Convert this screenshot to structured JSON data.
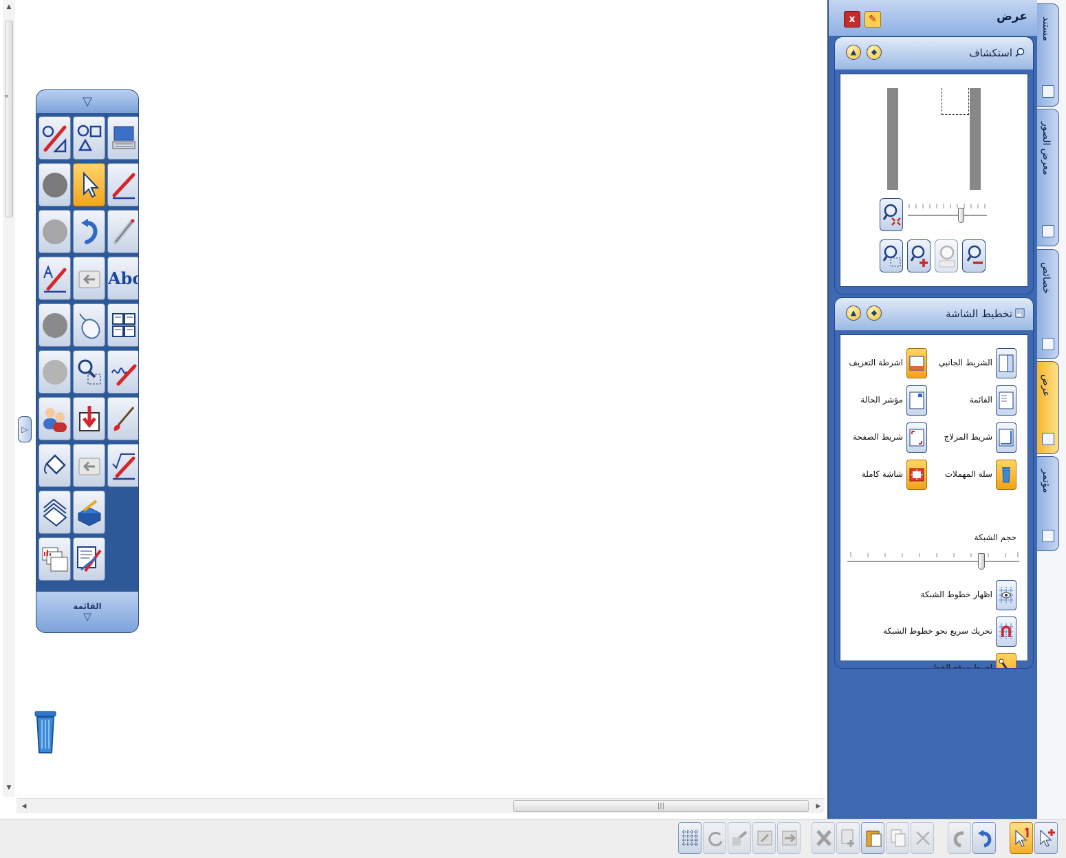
{
  "toolbox": {
    "footer_label": "القائمة",
    "tools": [
      {
        "icon": "magic-pen-icon"
      },
      {
        "icon": "shapes-icon"
      },
      {
        "icon": "on-screen-keyboard-icon"
      },
      {
        "icon": "gray-circle-icon"
      },
      {
        "icon": "select-pointer-icon",
        "active": true
      },
      {
        "icon": "pen-icon"
      },
      {
        "icon": "gray-circle-icon"
      },
      {
        "icon": "undo-icon"
      },
      {
        "icon": "highlighter-icon"
      },
      {
        "icon": "text-pen-icon"
      },
      {
        "icon": "back-arrow-icon"
      },
      {
        "icon": "text-tool-icon",
        "text": "Abc"
      },
      {
        "icon": "gray-circle-icon"
      },
      {
        "icon": "mouse-icon"
      },
      {
        "icon": "table-layout-icon"
      },
      {
        "icon": "gray-circle-icon"
      },
      {
        "icon": "zoom-region-icon"
      },
      {
        "icon": "handwriting-icon"
      },
      {
        "icon": "users-icon"
      },
      {
        "icon": "import-arrow-icon"
      },
      {
        "icon": "brush-icon"
      },
      {
        "icon": "fill-bucket-icon"
      },
      {
        "icon": "back-arrow-icon"
      },
      {
        "icon": "math-pen-icon"
      },
      {
        "icon": "stacked-pages-icon"
      },
      {
        "icon": "toolbox-settings-icon"
      },
      {
        "icon": "empty-slot"
      },
      {
        "icon": "media-icon"
      },
      {
        "icon": "edit-tools-icon"
      }
    ]
  },
  "panel": {
    "title": "عرض",
    "explore": {
      "title": "استكشاف"
    },
    "layout": {
      "title": "تخطيط الشاشة",
      "items": [
        {
          "label": "الشريط الجانبي",
          "icon": "sidebar-layout-icon"
        },
        {
          "label": "اشرطة التعريف",
          "icon": "toolbars-layout-icon"
        },
        {
          "label": "القائمة",
          "icon": "menu-layout-icon"
        },
        {
          "label": "مؤشر الحالة",
          "icon": "status-indicator-icon"
        },
        {
          "label": "شريط المزلاج",
          "icon": "scrollbar-layout-icon"
        },
        {
          "label": "شريط الصفحة",
          "icon": "page-bar-icon"
        },
        {
          "label": "سلة المهملات",
          "icon": "trash-layout-icon"
        },
        {
          "label": "شاشة كاملة",
          "icon": "fullscreen-icon"
        }
      ],
      "grid_size_label": "حجم الشبكة",
      "options": [
        {
          "label": "اظهار خطوط الشبكة",
          "icon": "show-grid-icon"
        },
        {
          "label": "تحريك سريع نحو خطوط الشبكة",
          "icon": "snap-grid-icon"
        },
        {
          "label": "اضبط موقع الخط",
          "icon": "line-position-icon"
        }
      ]
    }
  },
  "tabs": [
    {
      "label": "مستند",
      "icon": "document-tab-icon"
    },
    {
      "label": "معرض الصور",
      "icon": "gallery-tab-icon"
    },
    {
      "label": "خصائص",
      "icon": "properties-tab-icon"
    },
    {
      "label": "عرض",
      "icon": "view-tab-icon",
      "active": true
    },
    {
      "label": "مؤتمر",
      "icon": "conference-tab-icon"
    }
  ],
  "colors": {
    "panel_blue": "#3f68b3",
    "active_yellow": "#f5b62e"
  }
}
